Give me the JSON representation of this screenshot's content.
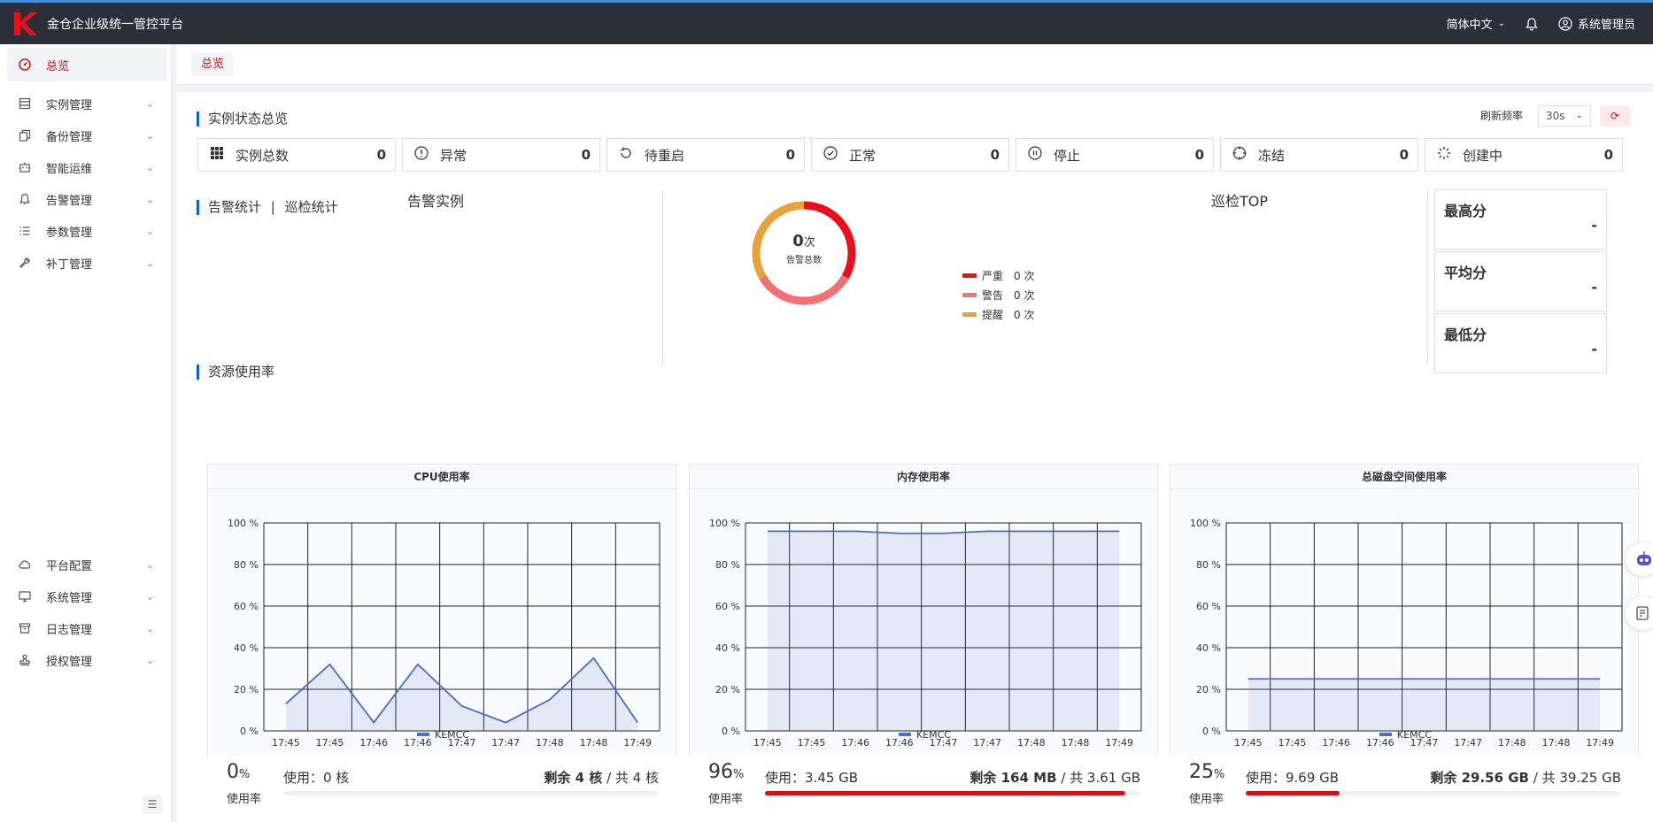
{
  "header": {
    "brand": "金仓企业级统一管控平台",
    "language": "简体中文",
    "user": "系统管理员"
  },
  "sidebar": {
    "items": [
      {
        "label": "总览",
        "icon": "dashboard-icon",
        "active": true
      },
      {
        "label": "实例管理",
        "icon": "database-icon"
      },
      {
        "label": "备份管理",
        "icon": "copy-icon"
      },
      {
        "label": "智能运维",
        "icon": "robot-icon"
      },
      {
        "label": "告警管理",
        "icon": "bell-icon"
      },
      {
        "label": "参数管理",
        "icon": "list-icon"
      },
      {
        "label": "补丁管理",
        "icon": "wrench-icon"
      }
    ],
    "bottom_items": [
      {
        "label": "平台配置",
        "icon": "cloud-icon"
      },
      {
        "label": "系统管理",
        "icon": "monitor-icon"
      },
      {
        "label": "日志管理",
        "icon": "archive-icon"
      },
      {
        "label": "授权管理",
        "icon": "stamp-icon"
      }
    ]
  },
  "tabs": [
    {
      "label": "总览"
    }
  ],
  "instance_overview": {
    "title": "实例状态总览",
    "refresh_label": "刷新频率",
    "refresh_value": "30s",
    "stats": [
      {
        "label": "实例总数",
        "value": "0",
        "icon": "grid-icon"
      },
      {
        "label": "异常",
        "value": "0",
        "icon": "alert-circle-icon"
      },
      {
        "label": "待重启",
        "value": "0",
        "icon": "restart-icon"
      },
      {
        "label": "正常",
        "value": "0",
        "icon": "check-circle-icon"
      },
      {
        "label": "停止",
        "value": "0",
        "icon": "pause-icon"
      },
      {
        "label": "冻结",
        "value": "0",
        "icon": "snowflake-icon"
      },
      {
        "label": "创建中",
        "value": "0",
        "icon": "loading-icon"
      }
    ]
  },
  "alert_section": {
    "title_a": "告警统计",
    "sep": "|",
    "title_b": "巡检统计",
    "alert_instances_title": "告警实例",
    "donut_total": "0",
    "donut_unit": "次",
    "donut_caption": "告警总数",
    "legend": [
      {
        "label": "严重",
        "value": "0 次",
        "color": "#e8101a"
      },
      {
        "label": "警告",
        "value": "0 次",
        "color": "#f47076"
      },
      {
        "label": "提醒",
        "value": "0 次",
        "color": "#e8a23a"
      }
    ],
    "inspection_top_title": "巡检TOP",
    "scores": [
      {
        "label": "最高分",
        "value": "-"
      },
      {
        "label": "平均分",
        "value": "-"
      },
      {
        "label": "最低分",
        "value": "-"
      }
    ]
  },
  "resource_section": {
    "title": "资源使用率"
  },
  "chart_data": [
    {
      "type": "area",
      "title": "CPU使用率",
      "x": [
        "17:45",
        "17:45",
        "17:46",
        "17:46",
        "17:47",
        "17:47",
        "17:48",
        "17:48",
        "17:49"
      ],
      "series": [
        {
          "name": "KEMCC",
          "values": [
            13,
            32,
            4,
            32,
            12,
            4,
            15,
            35,
            4
          ]
        }
      ],
      "yticks": [
        "100 %",
        "80 %",
        "60 %",
        "40 %",
        "20 %",
        "0 %"
      ],
      "ylim": [
        0,
        100
      ],
      "color": "#4b6cc4",
      "footer": {
        "pct": "0",
        "pct_unit": "%",
        "pct_label": "使用率",
        "used": "使用：0 核",
        "remain": "剩余 4 核",
        "total": "/ 共 4 核",
        "fraction": 0
      }
    },
    {
      "type": "area",
      "title": "内存使用率",
      "x": [
        "17:45",
        "17:45",
        "17:46",
        "17:46",
        "17:47",
        "17:47",
        "17:48",
        "17:48",
        "17:49"
      ],
      "series": [
        {
          "name": "KEMCC",
          "values": [
            96,
            96,
            96,
            95,
            95,
            96,
            96,
            96,
            96
          ]
        }
      ],
      "yticks": [
        "100 %",
        "80 %",
        "60 %",
        "40 %",
        "20 %",
        "0 %"
      ],
      "ylim": [
        0,
        100
      ],
      "color": "#4b6cc4",
      "footer": {
        "pct": "96",
        "pct_unit": "%",
        "pct_label": "使用率",
        "used": "使用：3.45 GB",
        "remain": "剩余 164 MB",
        "total": "/ 共 3.61 GB",
        "fraction": 0.96
      }
    },
    {
      "type": "area",
      "title": "总磁盘空间使用率",
      "x": [
        "17:45",
        "17:45",
        "17:46",
        "17:46",
        "17:47",
        "17:47",
        "17:48",
        "17:48",
        "17:49"
      ],
      "series": [
        {
          "name": "KEMCC",
          "values": [
            25,
            25,
            25,
            25,
            25,
            25,
            25,
            25,
            25
          ]
        }
      ],
      "yticks": [
        "100 %",
        "80 %",
        "60 %",
        "40 %",
        "20 %",
        "0 %"
      ],
      "ylim": [
        0,
        100
      ],
      "color": "#4b6cc4",
      "footer": {
        "pct": "25",
        "pct_unit": "%",
        "pct_label": "使用率",
        "used": "使用：9.69 GB",
        "remain": "剩余 29.56 GB",
        "total": "/ 共 39.25 GB",
        "fraction": 0.25
      }
    }
  ]
}
